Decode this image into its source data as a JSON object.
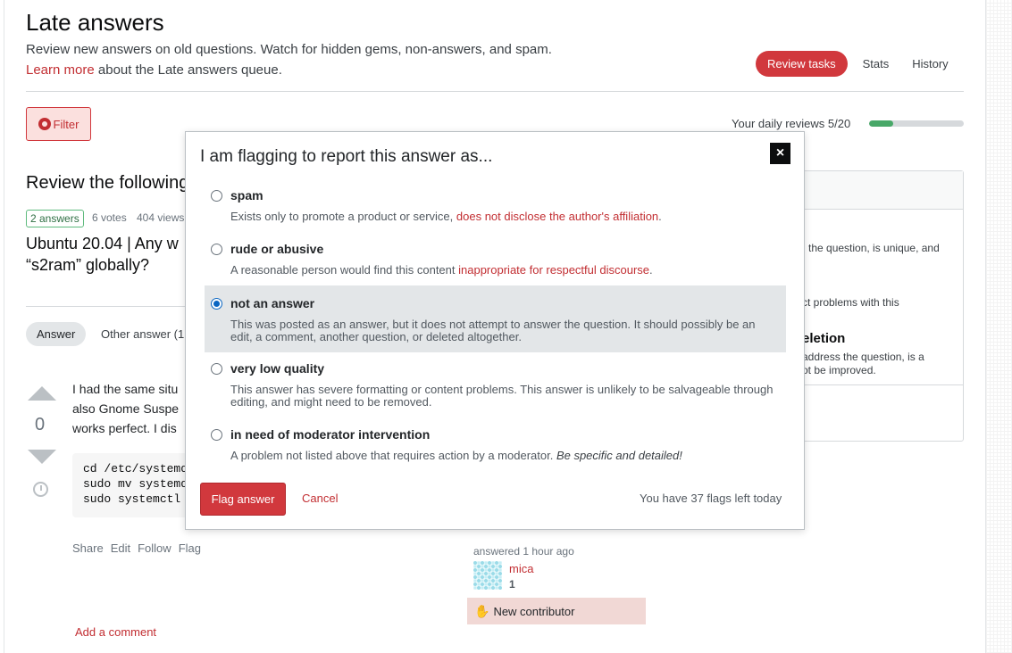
{
  "header": {
    "title": "Late answers",
    "subtitle": "Review new answers on old questions. Watch for hidden gems, non-answers, and spam.",
    "learn_link": "Learn more",
    "learn_suffix": " about the Late answers queue.",
    "tabs": [
      {
        "label": "Review tasks"
      },
      {
        "label": "Stats"
      },
      {
        "label": "History"
      }
    ]
  },
  "toolbar": {
    "filter_label": "Filter",
    "daily_reviews": "Your daily reviews 5/20",
    "daily_progress": 0.25
  },
  "review": {
    "heading": "Review the following",
    "answers_badge": "2 answers",
    "votes": "6 votes",
    "views": "404 views",
    "question_title": "Ubuntu 20.04 | Any w\n“s2ram” globally?",
    "answer_tab": "Answer",
    "other_tab": "Other answer (1"
  },
  "post": {
    "vote_count": "0",
    "text_lines": [
      "I had the same situ",
      "also Gnome Suspe",
      "works perfect. I dis"
    ],
    "code": "cd /etc/systemd\nsudo mv systemd\nsudo systemctl ",
    "menu": [
      "Share",
      "Edit",
      "Follow",
      "Flag"
    ],
    "answered": "answered 1 hour ago",
    "user_name": "mica",
    "user_rep": "1",
    "new_contributor": "New contributor",
    "add_comment": "Add a comment"
  },
  "sidebar": {
    "text1": "the question, is unique, and",
    "text2": "ct problems with this",
    "head2": "eletion",
    "text3_line1": "address the question, is a",
    "text3_line2": "ot be improved."
  },
  "modal": {
    "title": "I am flagging to report this answer as...",
    "close": "×",
    "options": [
      {
        "label": "spam",
        "desc": "Exists only to promote a product or service, ",
        "desc_red": "does not disclose the author's affiliation",
        "desc_end": "."
      },
      {
        "label": "rude or abusive",
        "desc": "A reasonable person would find this content ",
        "desc_red": "inappropriate for respectful discourse",
        "desc_end": "."
      },
      {
        "label": "not an answer",
        "desc": "This was posted as an answer, but it does not attempt to answer the question. It should possibly be an edit, a comment, another question, or deleted altogether."
      },
      {
        "label": "very low quality",
        "desc": "This answer has severe formatting or content problems. This answer is unlikely to be salvageable through editing, and might need to be removed."
      },
      {
        "label": "in need of moderator intervention",
        "desc": "A problem not listed above that requires action by a moderator. ",
        "desc_em": "Be specific and detailed!"
      }
    ],
    "selected_option": "not an answer",
    "flag_button": "Flag answer",
    "cancel": "Cancel",
    "flags_left": "You have 37 flags left today"
  },
  "colors": {
    "accent": "#d1383d",
    "link": "#c22e32",
    "progress": "#48a868",
    "radio_selected": "#0a66c2"
  }
}
